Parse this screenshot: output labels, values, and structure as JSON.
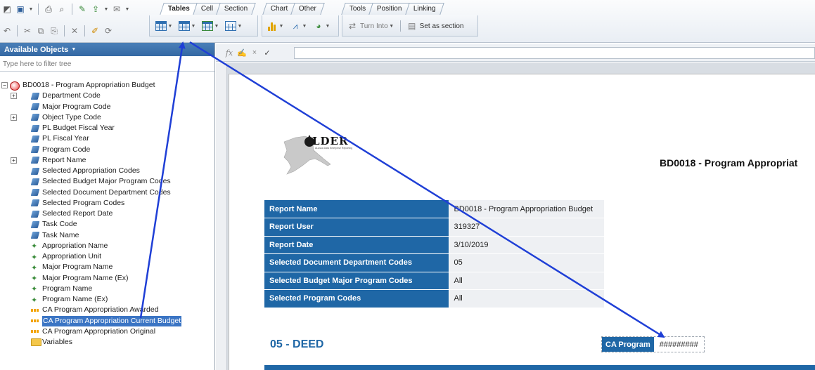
{
  "ribbon": {
    "tabs_group1": [
      "Tables",
      "Cell",
      "Section"
    ],
    "tabs_group2": [
      "Chart",
      "Other"
    ],
    "tabs_group3": [
      "Tools",
      "Position",
      "Linking"
    ],
    "turn_into_label": "Turn Into",
    "set_as_section_label": "Set as section"
  },
  "left_panel": {
    "header": "Available Objects",
    "filter_placeholder": "Type here to filter tree",
    "tree": [
      {
        "label": "BD0018 - Program Appropriation Budget",
        "icon": "universe-icon",
        "expander": "−",
        "level": 0
      },
      {
        "label": "Department Code",
        "icon": "dimension-icon",
        "expander": "+",
        "level": 1
      },
      {
        "label": "Major Program Code",
        "icon": "dimension-icon",
        "expander": "",
        "level": 1
      },
      {
        "label": "Object Type Code",
        "icon": "dimension-icon",
        "expander": "+",
        "level": 1
      },
      {
        "label": "PL Budget Fiscal Year",
        "icon": "dimension-icon",
        "expander": "",
        "level": 1
      },
      {
        "label": "PL Fiscal Year",
        "icon": "dimension-icon",
        "expander": "",
        "level": 1
      },
      {
        "label": "Program Code",
        "icon": "dimension-icon",
        "expander": "",
        "level": 1
      },
      {
        "label": "Report Name",
        "icon": "dimension-icon",
        "expander": "+",
        "level": 1
      },
      {
        "label": "Selected Appropriation Codes",
        "icon": "dimension-icon",
        "expander": "",
        "level": 1
      },
      {
        "label": "Selected Budget Major Program Codes",
        "icon": "dimension-icon",
        "expander": "",
        "level": 1
      },
      {
        "label": "Selected Document Department Codes",
        "icon": "dimension-icon",
        "expander": "",
        "level": 1
      },
      {
        "label": "Selected Program Codes",
        "icon": "dimension-icon",
        "expander": "",
        "level": 1
      },
      {
        "label": "Selected Report Date",
        "icon": "dimension-icon",
        "expander": "",
        "level": 1
      },
      {
        "label": "Task Code",
        "icon": "dimension-icon",
        "expander": "",
        "level": 1
      },
      {
        "label": "Task Name",
        "icon": "dimension-icon",
        "expander": "",
        "level": 1
      },
      {
        "label": "Appropriation Name",
        "icon": "attribute-icon",
        "expander": "",
        "level": 1
      },
      {
        "label": "Appropriation Unit",
        "icon": "attribute-icon",
        "expander": "",
        "level": 1
      },
      {
        "label": "Major Program Name",
        "icon": "attribute-icon",
        "expander": "",
        "level": 1
      },
      {
        "label": "Major Program Name (Ex)",
        "icon": "attribute-icon",
        "expander": "",
        "level": 1
      },
      {
        "label": "Program Name",
        "icon": "attribute-icon",
        "expander": "",
        "level": 1
      },
      {
        "label": "Program Name (Ex)",
        "icon": "attribute-icon",
        "expander": "",
        "level": 1
      },
      {
        "label": "CA Program Appropriation Awarded",
        "icon": "measure-icon",
        "expander": "",
        "level": 1
      },
      {
        "label": "CA Program Appropriation Current Budget",
        "icon": "measure-icon",
        "expander": "",
        "level": 1,
        "selected": true
      },
      {
        "label": "CA Program Appropriation Original",
        "icon": "measure-icon",
        "expander": "",
        "level": 1
      },
      {
        "label": "Variables",
        "icon": "folder-icon",
        "expander": "",
        "level": 1
      }
    ]
  },
  "formula_bar": {
    "fx": "fx",
    "cancel": "×",
    "confirm": "✓"
  },
  "report": {
    "logo_text": "LDER",
    "logo_sub": "ALaska Data Enterprise Reporting",
    "title": "BD0018 -  Program Appropriat",
    "info_rows": [
      {
        "key": "Report Name",
        "value": "BD0018 -  Program Appropriation Budget"
      },
      {
        "key": "Report User",
        "value": "319327"
      },
      {
        "key": "Report Date",
        "value": "3/10/2019"
      },
      {
        "key": "Selected Document Department Codes",
        "value": "05"
      },
      {
        "key": "Selected Budget Major Program Codes",
        "value": "All"
      },
      {
        "key": "Selected Program Codes",
        "value": "All"
      }
    ],
    "section_title": "05 - DEED",
    "ca_label": "CA Program",
    "ca_value": "#########"
  },
  "colors": {
    "accent": "#1f67a6",
    "arrow": "#1f3fd6",
    "selection": "#3b75c4"
  }
}
